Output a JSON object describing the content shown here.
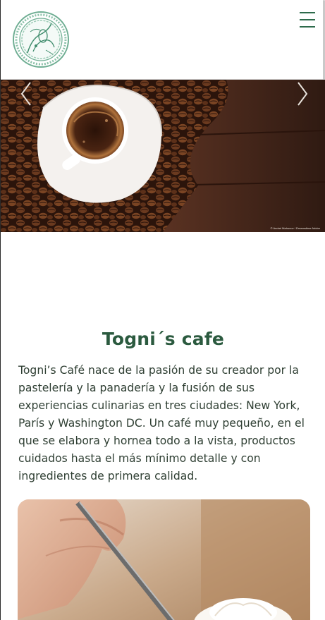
{
  "header": {
    "logo_icon": "cafe-crest-logo",
    "menu_icon": "hamburger-menu-icon"
  },
  "hero": {
    "image": "coffee-cup-with-beans",
    "prev_icon": "chevron-left-icon",
    "next_icon": "chevron-right-icon",
    "credit": "© Andrei Mahonov / Dreamstime Adobe"
  },
  "about": {
    "title": "Togni´s cafe",
    "description": "Togni’s Café nace de la pasión de su creador por la pastelería y la panadería y la fusión de sus experiencias culinarias en tres ciudades: New York, París y Washington DC. Un café muy pequeño, en el que se elabora y hornea todo a la vista, productos cuidados hasta el más mínimo detalle y con ingredientes de primera calidad."
  },
  "photo": {
    "image": "hand-piping-meringue"
  },
  "colors": {
    "brand_green": "#2b5a3f",
    "text": "#2f3f33"
  }
}
